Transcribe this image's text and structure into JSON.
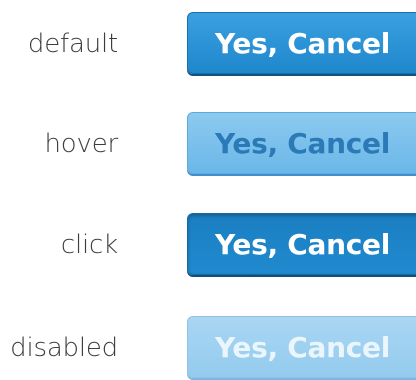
{
  "states": [
    {
      "label": "default",
      "button_label": "Yes, Cancel"
    },
    {
      "label": "hover",
      "button_label": "Yes, Cancel"
    },
    {
      "label": "click",
      "button_label": "Yes, Cancel"
    },
    {
      "label": "disabled",
      "button_label": "Yes, Cancel"
    }
  ],
  "colors": {
    "default_bg": "#2a92d6",
    "hover_bg": "#7cc0ec",
    "click_bg": "#1f84c8",
    "disabled_bg": "#a0d0f0"
  }
}
